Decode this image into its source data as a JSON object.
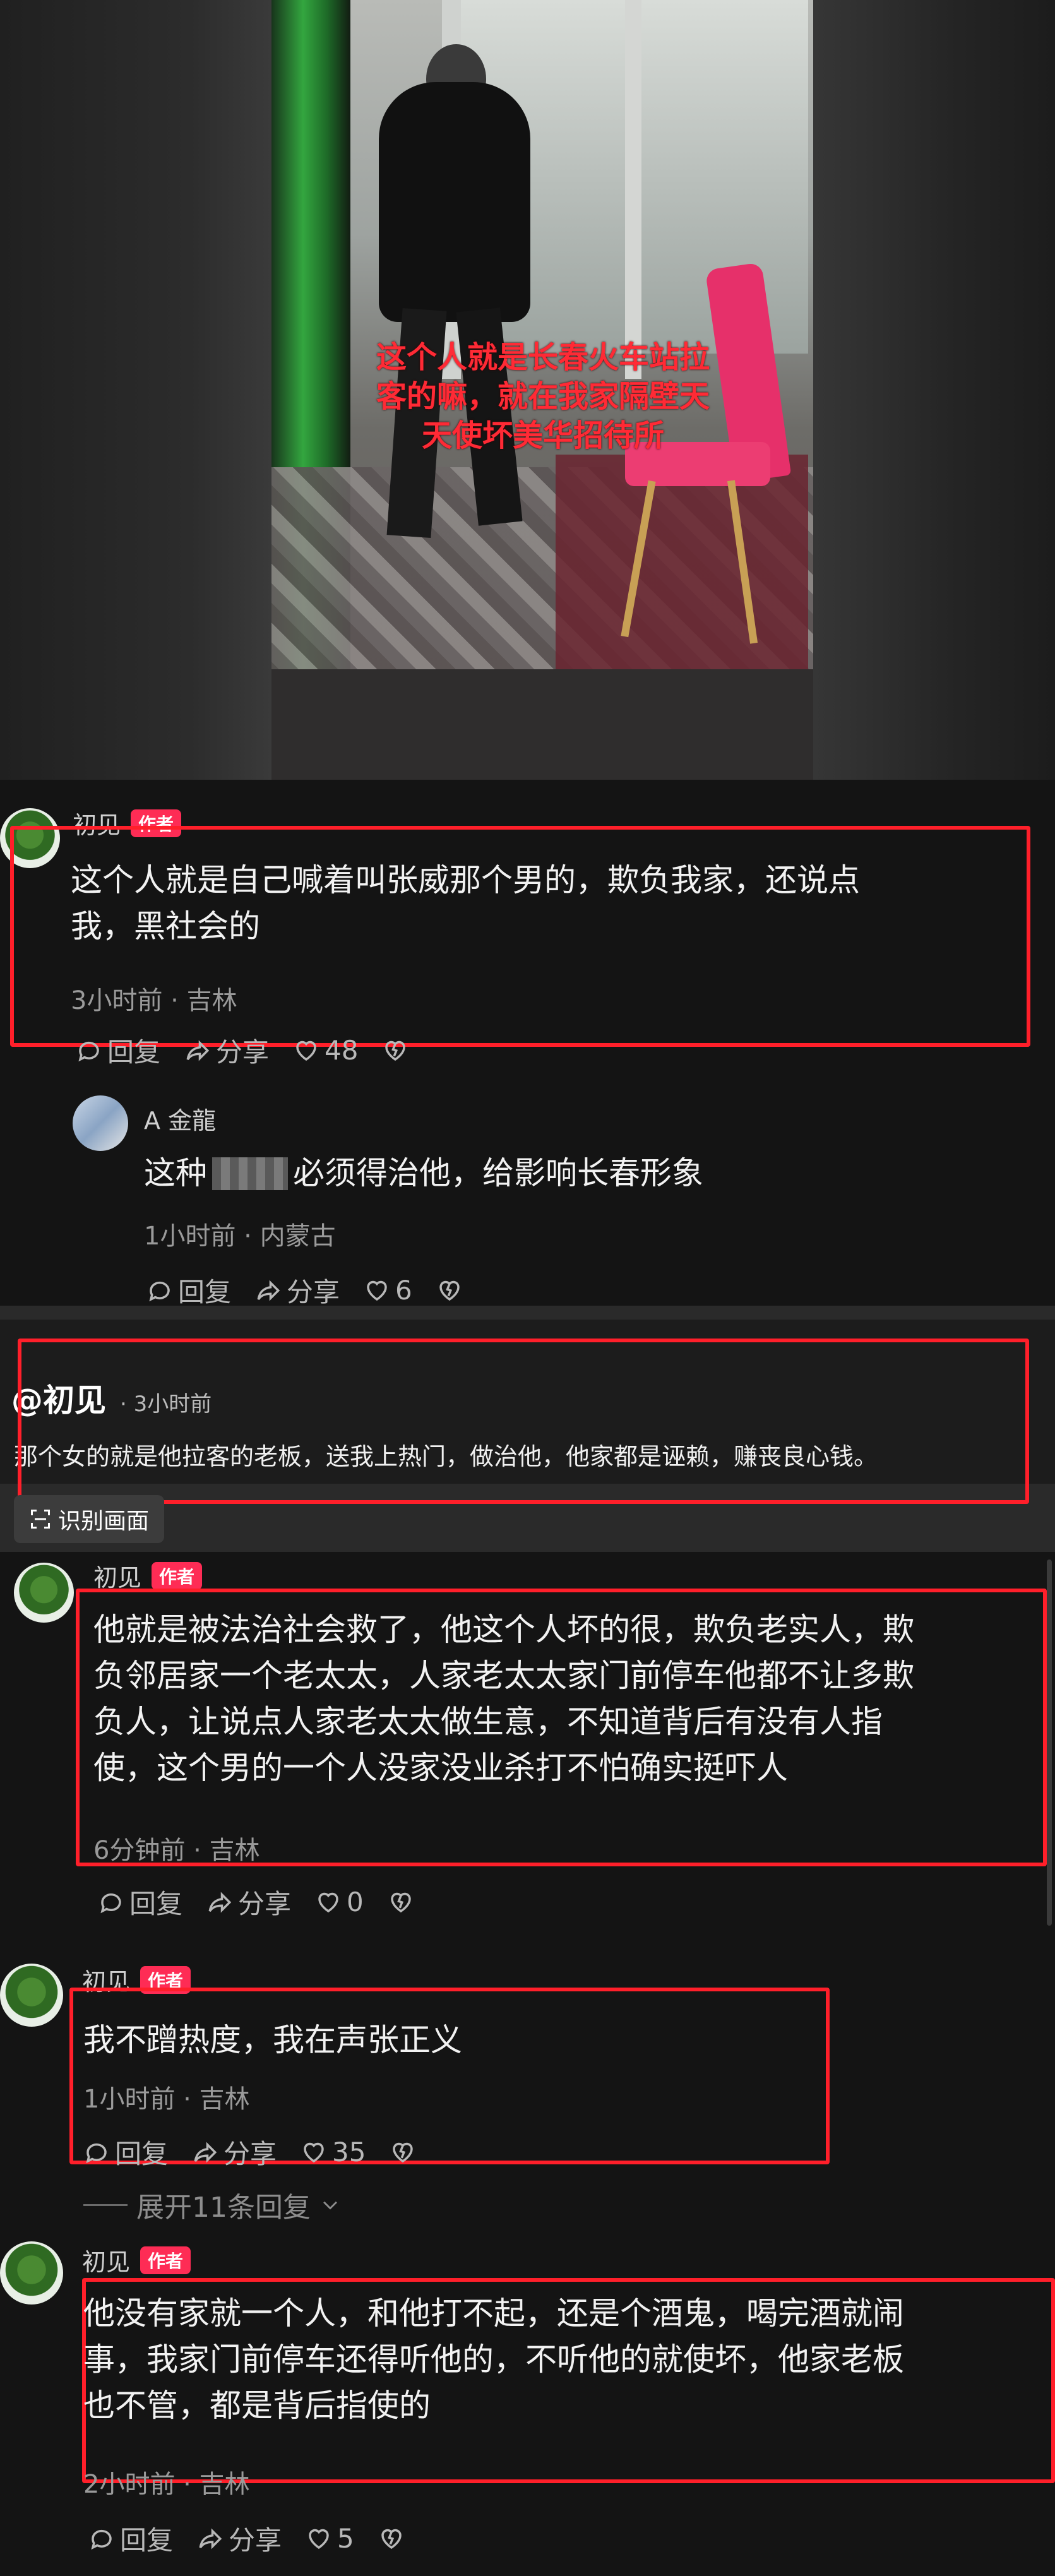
{
  "video": {
    "caption_lines": [
      "这个人就是长春火车站拉",
      "客的嘛，就在我家隔壁天",
      "天使坏美华招待所"
    ]
  },
  "comment1": {
    "user": "初见",
    "badge": "作者",
    "text_lines": [
      "这个人就是自己喊着叫张威那个男的，欺负我家，还说点",
      "我，黑社会的"
    ],
    "meta": "3小时前 · 吉林",
    "reply_label": "回复",
    "share_label": "分享",
    "likes": "48"
  },
  "reply1": {
    "user": "A 金龍",
    "text_before": "这种",
    "text_after": "必须得治他，给影响长春形象",
    "meta": "1小时前 · 内蒙古",
    "reply_label": "回复",
    "share_label": "分享",
    "likes": "6"
  },
  "quote": {
    "user": "@初见",
    "time": "· 3小时前",
    "text": "那个女的就是他拉客的老板，送我上热门，做治他，他家都是诬赖，赚丧良心钱。",
    "ocr_label": "识别画面"
  },
  "comment2": {
    "user": "初见",
    "badge": "作者",
    "text_lines": [
      "他就是被法治社会救了，他这个人坏的很，欺负老实人，欺",
      "负邻居家一个老太太，人家老太太家门前停车他都不让多欺",
      "负人，让说点人家老太太做生意，不知道背后有没有人指",
      "使，这个男的一个人没家没业杀打不怕确实挺吓人"
    ],
    "meta": "6分钟前 · 吉林",
    "reply_label": "回复",
    "share_label": "分享",
    "likes": "0"
  },
  "comment3": {
    "user": "初见",
    "badge": "作者",
    "text": "我不蹭热度，我在声张正义",
    "meta": "1小时前 · 吉林",
    "reply_label": "回复",
    "share_label": "分享",
    "likes": "35"
  },
  "expand": {
    "label": "展开11条回复"
  },
  "comment4": {
    "user": "初见",
    "badge": "作者",
    "text_lines": [
      "他没有家就一个人，和他打不起，还是个酒鬼，喝完酒就闹",
      "事，我家门前停车还得听他的，不听他的就使坏，他家老板",
      "也不管，都是背后指使的"
    ],
    "meta": "2小时前 · 吉林",
    "reply_label": "回复",
    "share_label": "分享",
    "likes": "5"
  },
  "colors": {
    "highlight_box": "#ff1f2a",
    "author_badge": "#fe2c55",
    "caption": "#ff2a35",
    "background": "#141414"
  },
  "icons": [
    "comment-icon",
    "share-icon",
    "heart-icon",
    "dislike-icon",
    "chevron-down-icon",
    "scan-icon"
  ]
}
